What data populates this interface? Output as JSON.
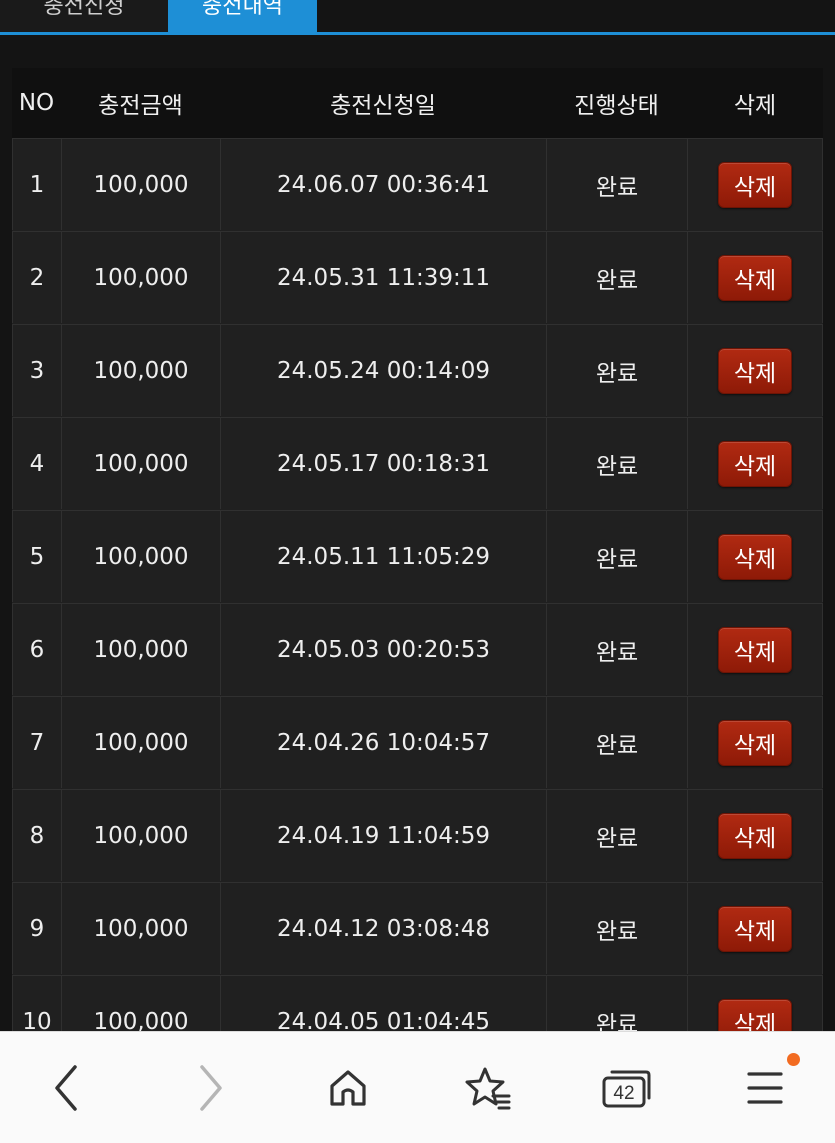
{
  "tabs": {
    "apply_label": "충전신청",
    "history_label": "충전내역"
  },
  "table": {
    "headers": {
      "no": "NO",
      "amount": "충전금액",
      "date": "충전신청일",
      "status": "진행상태",
      "delete": "삭제"
    },
    "rows": [
      {
        "no": "1",
        "amount": "100,000",
        "date": "24.06.07 00:36:41",
        "status": "완료",
        "action": "삭제"
      },
      {
        "no": "2",
        "amount": "100,000",
        "date": "24.05.31 11:39:11",
        "status": "완료",
        "action": "삭제"
      },
      {
        "no": "3",
        "amount": "100,000",
        "date": "24.05.24 00:14:09",
        "status": "완료",
        "action": "삭제"
      },
      {
        "no": "4",
        "amount": "100,000",
        "date": "24.05.17 00:18:31",
        "status": "완료",
        "action": "삭제"
      },
      {
        "no": "5",
        "amount": "100,000",
        "date": "24.05.11 11:05:29",
        "status": "완료",
        "action": "삭제"
      },
      {
        "no": "6",
        "amount": "100,000",
        "date": "24.05.03 00:20:53",
        "status": "완료",
        "action": "삭제"
      },
      {
        "no": "7",
        "amount": "100,000",
        "date": "24.04.26 10:04:57",
        "status": "완료",
        "action": "삭제"
      },
      {
        "no": "8",
        "amount": "100,000",
        "date": "24.04.19 11:04:59",
        "status": "완료",
        "action": "삭제"
      },
      {
        "no": "9",
        "amount": "100,000",
        "date": "24.04.12 03:08:48",
        "status": "완료",
        "action": "삭제"
      },
      {
        "no": "10",
        "amount": "100,000",
        "date": "24.04.05 01:04:45",
        "status": "완료",
        "action": "삭제"
      }
    ]
  },
  "browser_nav": {
    "tab_count": "42",
    "icons": [
      "back-arrow-icon",
      "forward-arrow-icon",
      "home-icon",
      "bookmark-star-icon",
      "tabs-icon",
      "menu-icon"
    ]
  },
  "colors": {
    "accent": "#1e8fd6",
    "delete_button": "#a12310",
    "notification_dot": "#f26b21"
  }
}
